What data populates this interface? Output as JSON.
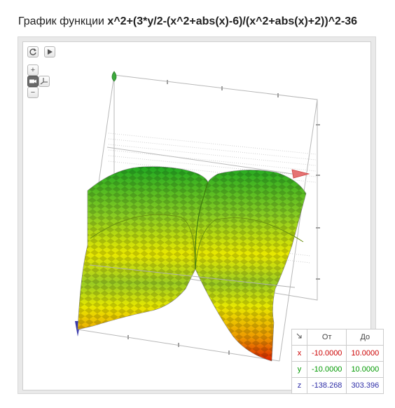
{
  "title": {
    "prefix": "График функции",
    "function": "x^2+(3*y/2-(x^2+abs(x)-6)/(x^2+abs(x)+2))^2-36"
  },
  "controls": {
    "reset_icon": "refresh-icon",
    "play_icon": "play-icon",
    "zoom_in": "+",
    "zoom_out": "−",
    "view_icon": "camera-icon",
    "axes_icon": "axes-icon"
  },
  "range_table": {
    "corner_icon": "diagonal-arrow-icon",
    "headers": [
      "От",
      "До"
    ],
    "rows": [
      {
        "axis": "x",
        "from": "-10.0000",
        "to": "10.0000",
        "color": "#cc0000"
      },
      {
        "axis": "y",
        "from": "-10.0000",
        "to": "10.0000",
        "color": "#009900"
      },
      {
        "axis": "z",
        "from": "-138.268",
        "to": "303.396",
        "color": "#2f2fa8"
      }
    ]
  },
  "colors": {
    "surface_top": "#33bb33",
    "surface_mid": "#e8e800",
    "surface_bottom": "#dd2200",
    "x_axis_arrow": "#dd4444",
    "z_axis_arrow": "#44aa44",
    "y_axis_arrow": "#3333aa"
  }
}
